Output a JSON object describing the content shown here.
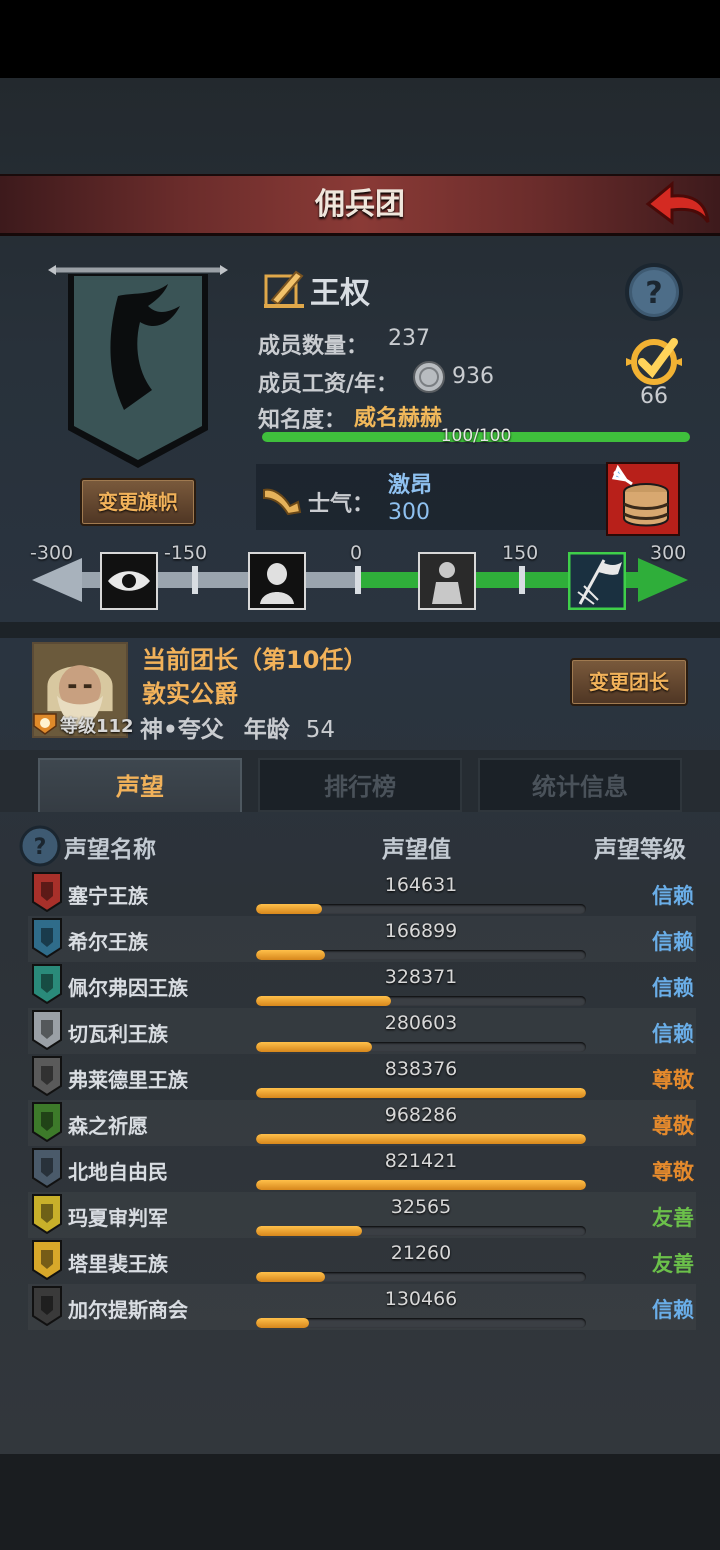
{
  "header": {
    "title": "佣兵团"
  },
  "banner": {
    "change_flag_label": "变更旗帜"
  },
  "mercenary": {
    "name": "王权",
    "members_label": "成员数量：",
    "members_value": "237",
    "wage_label": "成员工资/年：",
    "wage_value": "936",
    "fame_label": "知名度：",
    "fame_value": "威名赫赫",
    "fame_progress_text": "100/100",
    "fame_progress_fraction": 1.0,
    "achievement_value": "66"
  },
  "morale": {
    "label": "士气：",
    "state": "激昂",
    "value": "300",
    "scale_ticks": [
      "-300",
      "-150",
      "0",
      "150",
      "300"
    ],
    "scale_min": -300,
    "scale_max": 300,
    "current": 300
  },
  "leader": {
    "title_line": "当前团长（第10任）",
    "name": "敦实公爵",
    "level_label": "等级112",
    "trait": "神•夸父",
    "age_label": "年龄",
    "age_value": "54",
    "change_leader_label": "变更团长"
  },
  "tabs": [
    {
      "label": "声望",
      "active": true
    },
    {
      "label": "排行榜",
      "active": false
    },
    {
      "label": "统计信息",
      "active": false
    }
  ],
  "reputation_table": {
    "headers": {
      "name": "声望名称",
      "value": "声望值",
      "level": "声望等级"
    },
    "rows": [
      {
        "name": "塞宁王族",
        "value": "164631",
        "fill": 0.2,
        "level": "信赖",
        "level_color": "#6aaee8",
        "icon_color": "#a8302a",
        "icon": "crest-red-icon"
      },
      {
        "name": "希尔王族",
        "value": "166899",
        "fill": 0.21,
        "level": "信赖",
        "level_color": "#6aaee8",
        "icon_color": "#2f6c8a",
        "icon": "crest-blue-icon"
      },
      {
        "name": "佩尔弗因王族",
        "value": "328371",
        "fill": 0.41,
        "level": "信赖",
        "level_color": "#6aaee8",
        "icon_color": "#2a8a7a",
        "icon": "crest-teal-icon"
      },
      {
        "name": "切瓦利王族",
        "value": "280603",
        "fill": 0.35,
        "level": "信赖",
        "level_color": "#6aaee8",
        "icon_color": "#9aa0a6",
        "icon": "crest-scales-icon"
      },
      {
        "name": "弗莱德里王族",
        "value": "838376",
        "fill": 1.0,
        "level": "尊敬",
        "level_color": "#e58a2c",
        "icon_color": "#5a5a5a",
        "icon": "crest-dark-icon"
      },
      {
        "name": "森之祈愿",
        "value": "968286",
        "fill": 1.0,
        "level": "尊敬",
        "level_color": "#e58a2c",
        "icon_color": "#3d7a2a",
        "icon": "crest-tree-icon"
      },
      {
        "name": "北地自由民",
        "value": "821421",
        "fill": 1.0,
        "level": "尊敬",
        "level_color": "#e58a2c",
        "icon_color": "#4a5a6a",
        "icon": "crest-axe-icon"
      },
      {
        "name": "玛夏审判军",
        "value": "32565",
        "fill": 0.32,
        "level": "友善",
        "level_color": "#6bc04a",
        "icon_color": "#c8b02a",
        "icon": "crest-yellow-icon"
      },
      {
        "name": "塔里裴王族",
        "value": "21260",
        "fill": 0.21,
        "level": "友善",
        "level_color": "#6bc04a",
        "icon_color": "#d8a82a",
        "icon": "crest-gold-icon"
      },
      {
        "name": "加尔提斯商会",
        "value": "130466",
        "fill": 0.16,
        "level": "信赖",
        "level_color": "#6aaee8",
        "icon_color": "#3a3a3a",
        "icon": "crest-merchant-icon"
      }
    ]
  }
}
